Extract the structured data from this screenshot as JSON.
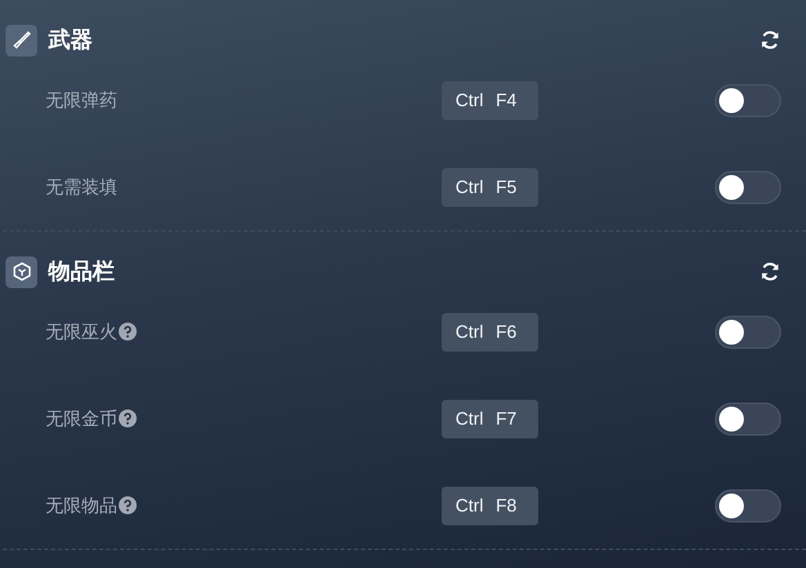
{
  "sections": [
    {
      "title": "武器",
      "rows": [
        {
          "label": "无限弹药",
          "help": false,
          "keys": [
            "Ctrl",
            "F4"
          ],
          "on": false
        },
        {
          "label": "无需装填",
          "help": false,
          "keys": [
            "Ctrl",
            "F5"
          ],
          "on": false
        }
      ]
    },
    {
      "title": "物品栏",
      "rows": [
        {
          "label": "无限巫火",
          "help": true,
          "keys": [
            "Ctrl",
            "F6"
          ],
          "on": false
        },
        {
          "label": "无限金币",
          "help": true,
          "keys": [
            "Ctrl",
            "F7"
          ],
          "on": false
        },
        {
          "label": "无限物品",
          "help": true,
          "keys": [
            "Ctrl",
            "F8"
          ],
          "on": false
        }
      ]
    }
  ]
}
